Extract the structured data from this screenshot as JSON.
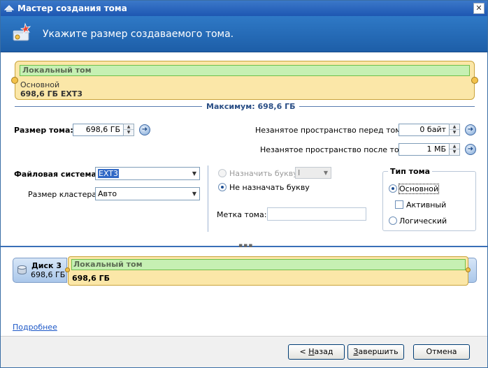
{
  "window": {
    "title": "Мастер создания тома",
    "close_glyph": "✕"
  },
  "header": {
    "title": "Укажите размер создаваемого тома.",
    "icon": "new-volume-wizard-icon"
  },
  "volume_bar": {
    "name": "Локальный том",
    "type": "Основной",
    "size_fs": "698,6 ГБ EXT3",
    "max_label": "Максимум: 698,6 ГБ"
  },
  "size": {
    "label": "Размер тома:",
    "value": "698,6 ГБ"
  },
  "before": {
    "label": "Незанятое пространство перед томом:",
    "value": "0 байт"
  },
  "after": {
    "label": "Незанятое пространство после тома:",
    "value": "1 МБ"
  },
  "filesystem": {
    "label": "Файловая система:",
    "value": "EXT3"
  },
  "cluster": {
    "label": "Размер кластера:",
    "value": "Авто"
  },
  "letter": {
    "assign_label": "Назначить букву:",
    "assign_value": "I",
    "none_label": "Не назначать букву",
    "selected": "none"
  },
  "volume_label": {
    "label": "Метка тома:",
    "value": ""
  },
  "volume_type": {
    "title": "Тип тома",
    "primary": "Основной",
    "active": "Активный",
    "logical": "Логический",
    "selected": "primary",
    "active_checked": false
  },
  "grip": "▪▪▪",
  "disk_map": {
    "disk_name": "Диск 3",
    "disk_size": "698,6 ГБ",
    "volume_name": "Локальный том",
    "volume_size": "698,6 ГБ"
  },
  "more_link": "Подробнее",
  "buttons": {
    "back_prefix": "< ",
    "back_accel": "Н",
    "back_rest": "азад",
    "finish_accel": "З",
    "finish_rest": "авершить",
    "cancel": "Отмена"
  },
  "arrows": {
    "up": "▲",
    "down": "▼",
    "go": "➜",
    "combo": "▼"
  },
  "colors": {
    "accent": "#1d5ea8",
    "volume_fill": "#fbe7a8",
    "volume_name_fill": "#c6f0b3"
  }
}
